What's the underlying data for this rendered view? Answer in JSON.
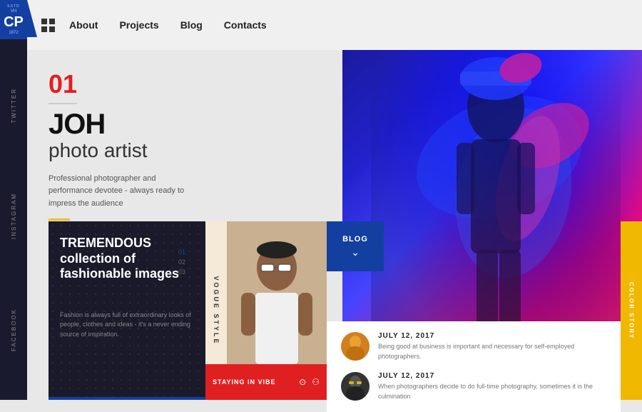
{
  "sidebar": {
    "logo": {
      "estd": "ESTD",
      "vh": "VH",
      "cp": "CP",
      "year": "1872"
    },
    "social": [
      "TWITTER",
      "INSTAGRAM",
      "FACEBOOK"
    ]
  },
  "nav": {
    "items": [
      "About",
      "Projects",
      "Blog",
      "Contacts"
    ]
  },
  "hero": {
    "number": "01",
    "name": "JOH",
    "title": "photo artist",
    "description": "Professional photographer and performance devotee - always ready to impress the audience"
  },
  "card_dark": {
    "title": "TREMENDOUS collection of fashionable images",
    "counters": [
      "01",
      "02",
      "03"
    ],
    "description": "Fashion is always full of extraordinary looks of people, clothes and ideas - it's a never ending source of inspiration."
  },
  "card_photo": {
    "label": "VOGUE STYLE",
    "bottom_text": "STAYING IN VIBE"
  },
  "blog": {
    "button_label": "BLOG",
    "posts": [
      {
        "date": "JULY 12, 2017",
        "text": "Being good at business is important and necessary for self-employed photographers."
      },
      {
        "date": "JULY 12, 2017",
        "text": "When photographers decide to do full-time photography, sometimes it is the culmination"
      }
    ]
  },
  "yellow_strip": {
    "text": "COLOR STORY"
  }
}
